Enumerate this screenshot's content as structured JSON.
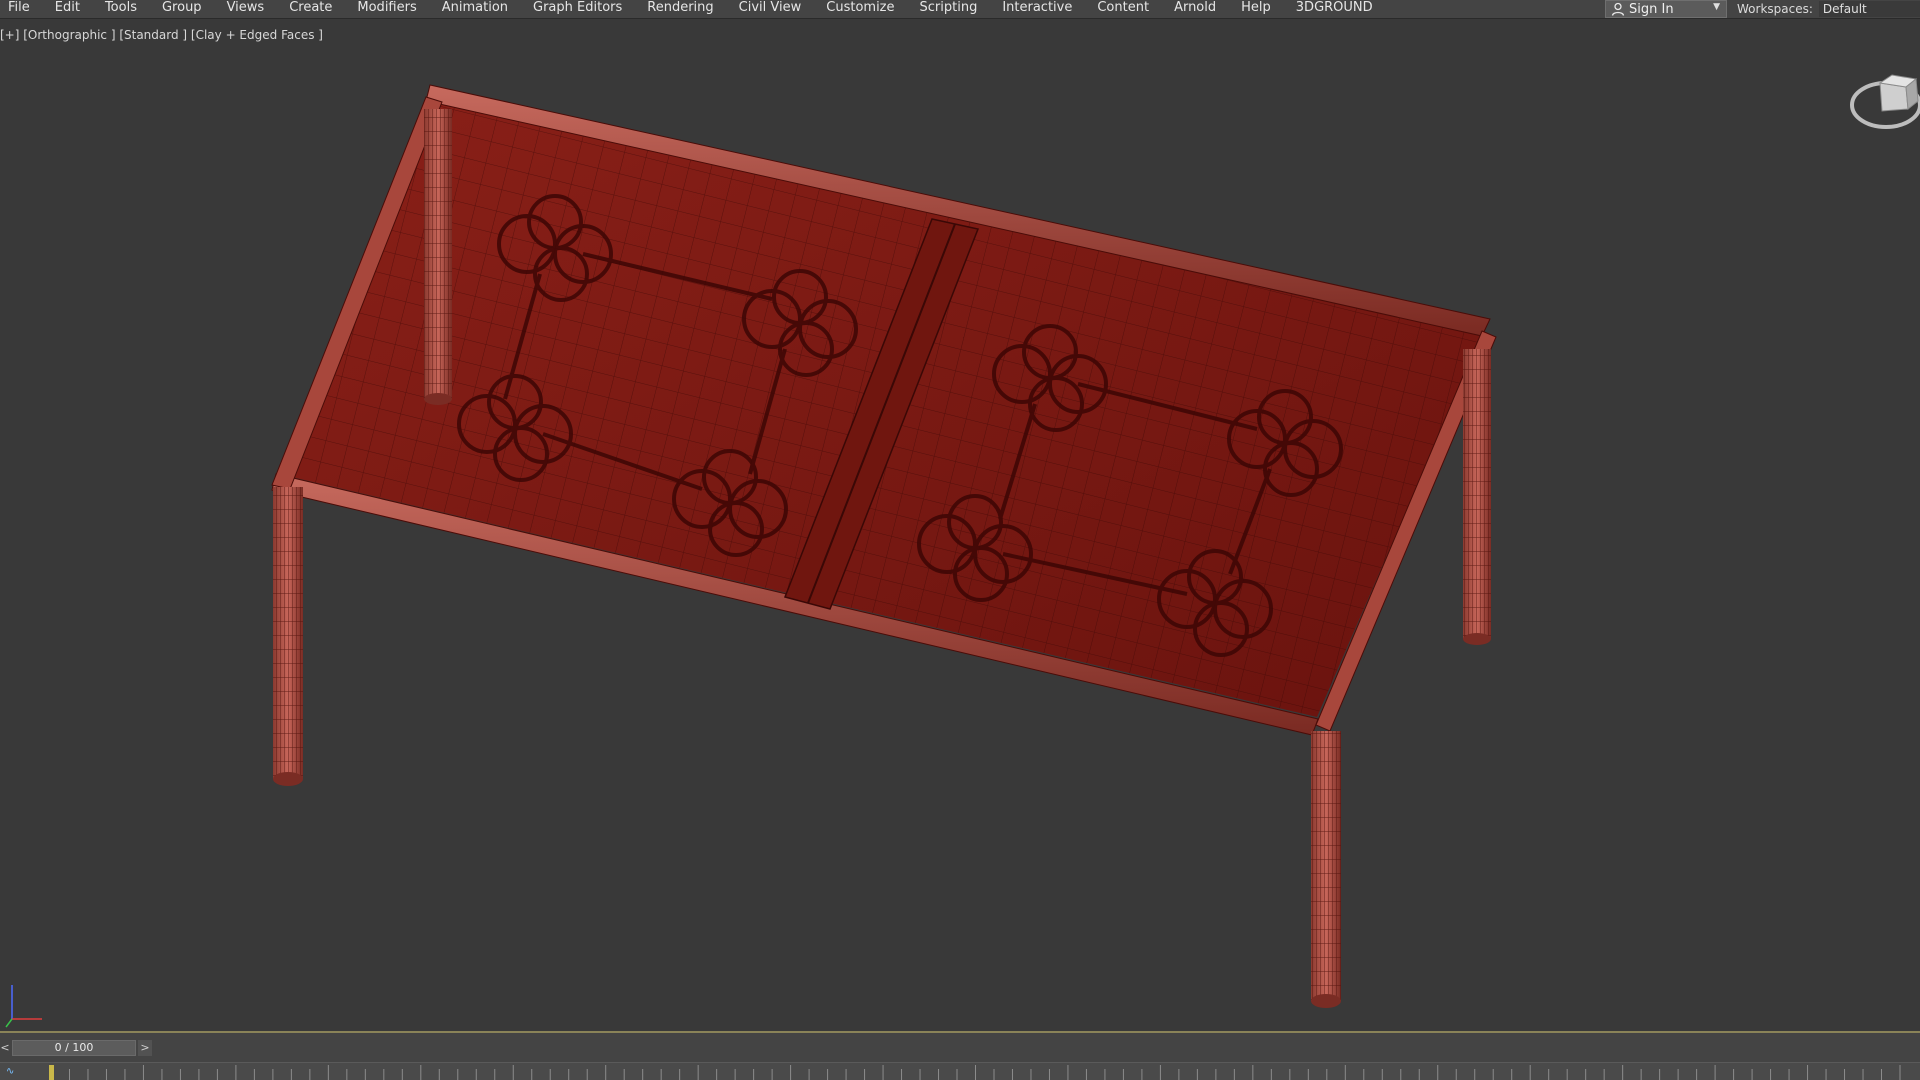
{
  "menu": {
    "items": [
      "File",
      "Edit",
      "Tools",
      "Group",
      "Views",
      "Create",
      "Modifiers",
      "Animation",
      "Graph Editors",
      "Rendering",
      "Civil View",
      "Customize",
      "Scripting",
      "Interactive",
      "Content",
      "Arnold",
      "Help",
      "3DGROUND"
    ]
  },
  "account": {
    "signin_label": "Sign In",
    "user_icon": "user-icon",
    "dropdown_icon": "chevron-down-icon"
  },
  "workspaces": {
    "label": "Workspaces:",
    "value": "Default"
  },
  "viewport": {
    "label": "[+] [Orthographic ] [Standard ] [Clay + Edged Faces ]",
    "model_color": "#7a1a14",
    "wire_color": "#3a0806",
    "background": "#393939",
    "viewcube_icon": "viewcube-icon",
    "axis_icon": "axis-tripod-icon"
  },
  "timeline": {
    "frame_label": "0 / 100",
    "prev_label": "<",
    "next_label": ">",
    "current_frame": 0,
    "total_frames": 100,
    "accent": "#c9b84a"
  }
}
